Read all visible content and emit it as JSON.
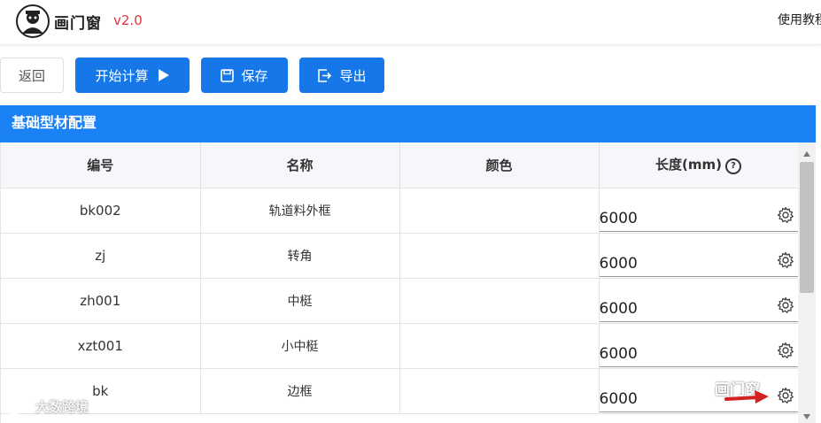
{
  "header": {
    "app_name": "画门窗",
    "version": "v2.0",
    "tutorial": "使用教程"
  },
  "toolbar": {
    "back_label": "返回",
    "start_label": "开始计算",
    "save_label": "保存",
    "export_label": "导出"
  },
  "panel": {
    "title": "基础型材配置"
  },
  "table": {
    "columns": [
      "编号",
      "名称",
      "颜色",
      "长度(mm)"
    ],
    "rows": [
      {
        "code": "bk002",
        "name": "轨道料外框",
        "color": "",
        "length": "6000"
      },
      {
        "code": "zj",
        "name": "转角",
        "color": "",
        "length": "6000"
      },
      {
        "code": "zh001",
        "name": "中梃",
        "color": "",
        "length": "6000"
      },
      {
        "code": "xzt001",
        "name": "小中梃",
        "color": "",
        "length": "6000"
      },
      {
        "code": "bk",
        "name": "边框",
        "color": "",
        "length": "6000"
      }
    ]
  },
  "watermarks": {
    "left": "大数跨境",
    "right": "画门窗"
  },
  "colors": {
    "primary": "#1677e8",
    "panel_header": "#1a82f5",
    "version": "#e0343a"
  }
}
